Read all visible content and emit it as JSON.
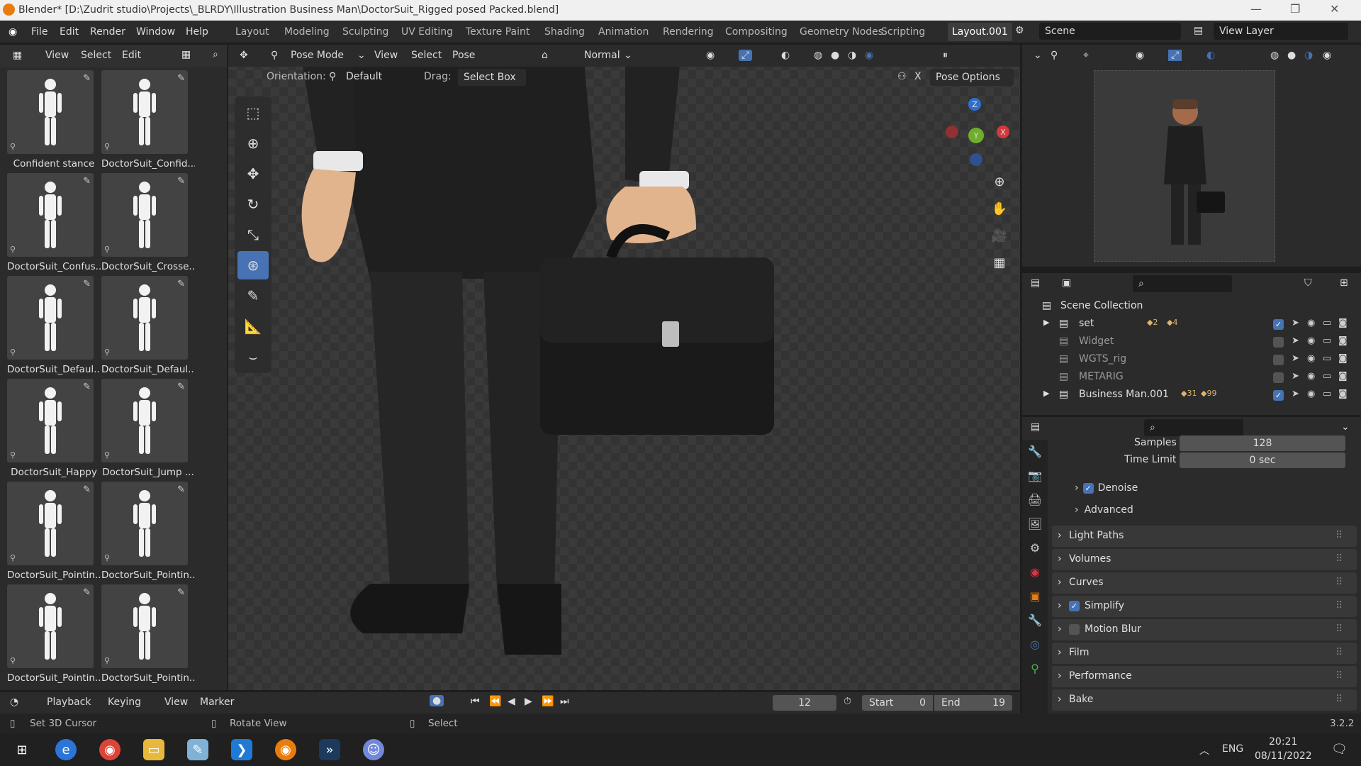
{
  "window": {
    "title": "Blender* [D:\\Zudrit studio\\Projects\\_BLRDY\\Illustration Business Man\\DoctorSuit_Rigged posed Packed.blend]"
  },
  "menu": [
    "File",
    "Edit",
    "Render",
    "Window",
    "Help"
  ],
  "workspaces": [
    "Layout",
    "Modeling",
    "Sculpting",
    "UV Editing",
    "Texture Paint",
    "Shading",
    "Animation",
    "Rendering",
    "Compositing",
    "Geometry Nodes",
    "Scripting",
    "Layout.001"
  ],
  "active_workspace": "Layout.001",
  "scene": {
    "label": "Scene",
    "view_layer": "View Layer"
  },
  "asset_browser": {
    "header_items": [
      "View",
      "Select",
      "Edit"
    ],
    "assets": [
      "Confident stance",
      "DoctorSuit_Confid...",
      "DoctorSuit_Confus...",
      "DoctorSuit_Crosse...",
      "DoctorSuit_Defaul...",
      "DoctorSuit_Defaul...",
      "DoctorSuit_Happy",
      "DoctorSuit_Jump ...",
      "DoctorSuit_Pointin...",
      "DoctorSuit_Pointin...",
      "DoctorSuit_Pointin...",
      "DoctorSuit_Pointin..."
    ]
  },
  "viewport": {
    "mode": "Pose Mode",
    "menus": [
      "View",
      "Select",
      "Pose"
    ],
    "shading": "Normal",
    "orientation_label": "Orientation:",
    "orientation": "Default",
    "drag_label": "Drag:",
    "drag": "Select Box",
    "pose_options": "Pose Options",
    "gizmo": {
      "z": "Z",
      "y": "Y",
      "x": "X"
    }
  },
  "outliner": {
    "root": "Scene Collection",
    "rows": [
      {
        "name": "set",
        "counts": [
          "2",
          "4"
        ]
      },
      {
        "name": "Widget"
      },
      {
        "name": "WGTS_rig"
      },
      {
        "name": "METARIG"
      },
      {
        "name": "Business Man.001",
        "counts": [
          "31",
          "99"
        ]
      }
    ]
  },
  "properties": {
    "samples_label": "Samples",
    "samples": "128",
    "time_limit_label": "Time Limit",
    "time_limit": "0 sec",
    "denoise": "Denoise",
    "advanced": "Advanced",
    "panels": [
      "Light Paths",
      "Volumes",
      "Curves",
      "Simplify",
      "Motion Blur",
      "Film",
      "Performance",
      "Bake"
    ]
  },
  "timeline": {
    "menus": [
      "Playback",
      "Keying",
      "View",
      "Marker"
    ],
    "frame": "12",
    "start_label": "Start",
    "start": "0",
    "end_label": "End",
    "end": "19"
  },
  "statusbar": {
    "left": "Set 3D Cursor",
    "middle": "Rotate View",
    "right": "Select",
    "version": "3.2.2"
  },
  "taskbar": {
    "lang": "ENG",
    "time": "20:21",
    "date": "08/11/2022"
  }
}
